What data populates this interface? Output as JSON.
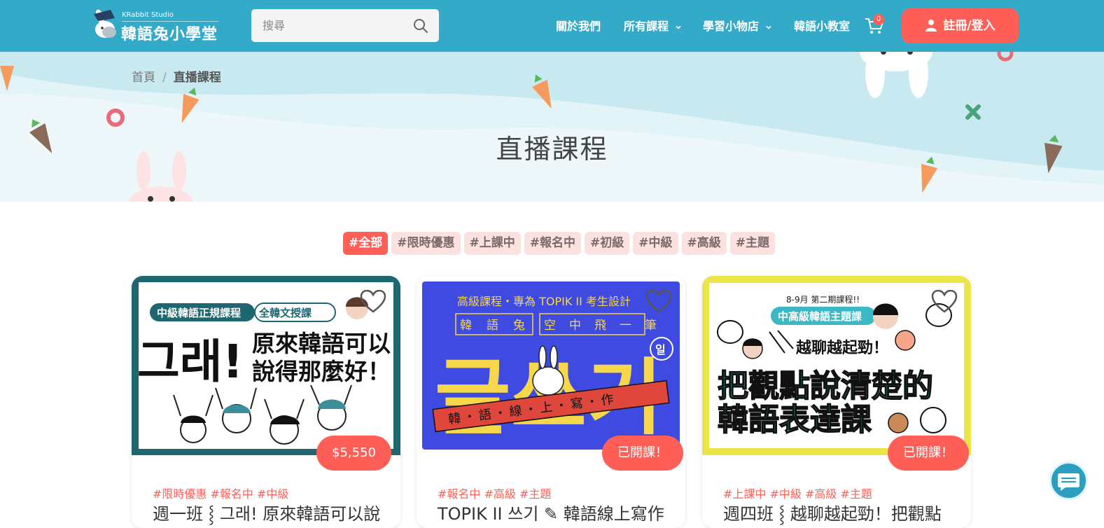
{
  "header": {
    "logo_studio": "KRabbit Studio",
    "logo_name": "韓語兔小學堂",
    "search_placeholder": "搜尋",
    "nav": [
      {
        "label": "關於我們"
      },
      {
        "label": "所有課程"
      },
      {
        "label": "學習小物店"
      },
      {
        "label": "韓語小教室"
      }
    ],
    "cart_count": "0",
    "login_label": "註冊/登入"
  },
  "breadcrumb": {
    "home": "首頁",
    "separator": "/",
    "current": "直播課程"
  },
  "page_title": "直播課程",
  "filter_tags": [
    "#全部",
    "#限時優惠",
    "#上課中",
    "#報名中",
    "#初級",
    "#中級",
    "#高級",
    "#主題"
  ],
  "cards": [
    {
      "image": {
        "badge_left": "中級韓語正規課程",
        "badge_right": "全韓文授課",
        "korean": "그래!",
        "headline_1": "原來韓語可以",
        "headline_2": "說得那麼好！"
      },
      "price": "$5,550",
      "tags": "#限時優惠 #報名中 #中級",
      "title": "週一班 ⸾ 그래! 原來韓語可以說"
    },
    {
      "image": {
        "top_line": "高級課程・專為 TOPIK II 考生設計",
        "box_chars": [
          "韓",
          "語",
          "兔",
          "空",
          "中",
          "飛",
          "一",
          "筆"
        ],
        "korean": "글쓰기",
        "circle_badge": "일",
        "ribbon": "韓・語・線・上・寫・作"
      },
      "price": "已開課！",
      "tags": "#報名中 #高級 #主題",
      "title": "TOPIK II 쓰기 ✎ 韓語線上寫作"
    },
    {
      "image": {
        "top_line": "8-9月 第二期課程!!",
        "badge": "中高級韓語主題課",
        "subline": "越聊越起勁！",
        "headline_1": "把觀點說清楚的",
        "headline_2": "韓語表達課"
      },
      "price": "已開課！",
      "tags": "#上課中 #中級 #高級 #主題",
      "title": "週四班 ⸾ 越聊越起勁！把觀點"
    }
  ],
  "colors": {
    "header": "#32aac8",
    "accent": "#ff5f57",
    "banner": "#c9e9f1",
    "tag_bg": "#fbe1df"
  },
  "icons": [
    "rabbit-logo-icon",
    "search-icon",
    "chevron-down-icon",
    "cart-icon",
    "user-icon",
    "heart-icon",
    "chat-icon"
  ]
}
